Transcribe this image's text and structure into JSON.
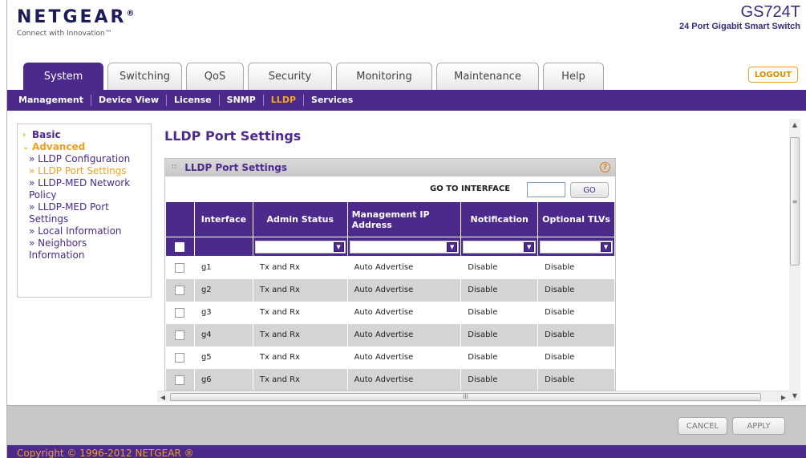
{
  "header": {
    "logo": "NETGEAR",
    "logo_mark": "®",
    "tagline": "Connect with Innovation™",
    "model": "GS724T",
    "model_desc": "24 Port Gigabit Smart Switch",
    "logout_label": "LOGOUT"
  },
  "tabs": [
    {
      "label": "System",
      "active": true
    },
    {
      "label": "Switching",
      "active": false
    },
    {
      "label": "QoS",
      "active": false
    },
    {
      "label": "Security",
      "active": false
    },
    {
      "label": "Monitoring",
      "active": false
    },
    {
      "label": "Maintenance",
      "active": false
    },
    {
      "label": "Help",
      "active": false
    }
  ],
  "subnav": [
    {
      "label": "Management",
      "active": false
    },
    {
      "label": "Device View",
      "active": false
    },
    {
      "label": "License",
      "active": false
    },
    {
      "label": "SNMP",
      "active": false
    },
    {
      "label": "LLDP",
      "active": true
    },
    {
      "label": "Services",
      "active": false
    }
  ],
  "sidebar": {
    "categories": [
      {
        "label": "Basic",
        "arrow": "›",
        "open": false
      },
      {
        "label": "Advanced",
        "arrow": "⌄",
        "open": true
      }
    ],
    "items": [
      {
        "label": "» LLDP Configuration",
        "active": false
      },
      {
        "label": "» LLDP Port Settings",
        "active": true
      },
      {
        "label": "» LLDP-MED Network",
        "active": false
      },
      {
        "label": "Policy",
        "active": false
      },
      {
        "label": "» LLDP-MED Port",
        "active": false
      },
      {
        "label": "Settings",
        "active": false
      },
      {
        "label": "» Local Information",
        "active": false
      },
      {
        "label": "» Neighbors",
        "active": false
      },
      {
        "label": "Information",
        "active": false
      }
    ]
  },
  "main": {
    "page_title": "LLDP Port Settings",
    "panel_title": "LLDP Port Settings",
    "help_icon": "?",
    "goto_label": "GO TO INTERFACE",
    "goto_value": "",
    "goto_button": "GO",
    "columns": [
      "Interface",
      "Admin Status",
      "Management IP Address",
      "Notification",
      "Optional TLVs"
    ],
    "rows": [
      {
        "interface": "g1",
        "admin_status": "Tx and Rx",
        "mgmt_ip": "Auto Advertise",
        "notification": "Disable",
        "optional_tlvs": "Disable"
      },
      {
        "interface": "g2",
        "admin_status": "Tx and Rx",
        "mgmt_ip": "Auto Advertise",
        "notification": "Disable",
        "optional_tlvs": "Disable"
      },
      {
        "interface": "g3",
        "admin_status": "Tx and Rx",
        "mgmt_ip": "Auto Advertise",
        "notification": "Disable",
        "optional_tlvs": "Disable"
      },
      {
        "interface": "g4",
        "admin_status": "Tx and Rx",
        "mgmt_ip": "Auto Advertise",
        "notification": "Disable",
        "optional_tlvs": "Disable"
      },
      {
        "interface": "g5",
        "admin_status": "Tx and Rx",
        "mgmt_ip": "Auto Advertise",
        "notification": "Disable",
        "optional_tlvs": "Disable"
      },
      {
        "interface": "g6",
        "admin_status": "Tx and Rx",
        "mgmt_ip": "Auto Advertise",
        "notification": "Disable",
        "optional_tlvs": "Disable"
      }
    ]
  },
  "scrollbar": {
    "grip": "III",
    "vgrip": "≡"
  },
  "buttons": {
    "cancel": "CANCEL",
    "apply": "APPLY"
  },
  "footer": {
    "copyright": "Copyright © 1996-2012 NETGEAR ®"
  },
  "colors": {
    "brand_purple": "#4b2a8c",
    "accent_orange": "#f0a020",
    "row_alt": "#d4d4d4"
  }
}
